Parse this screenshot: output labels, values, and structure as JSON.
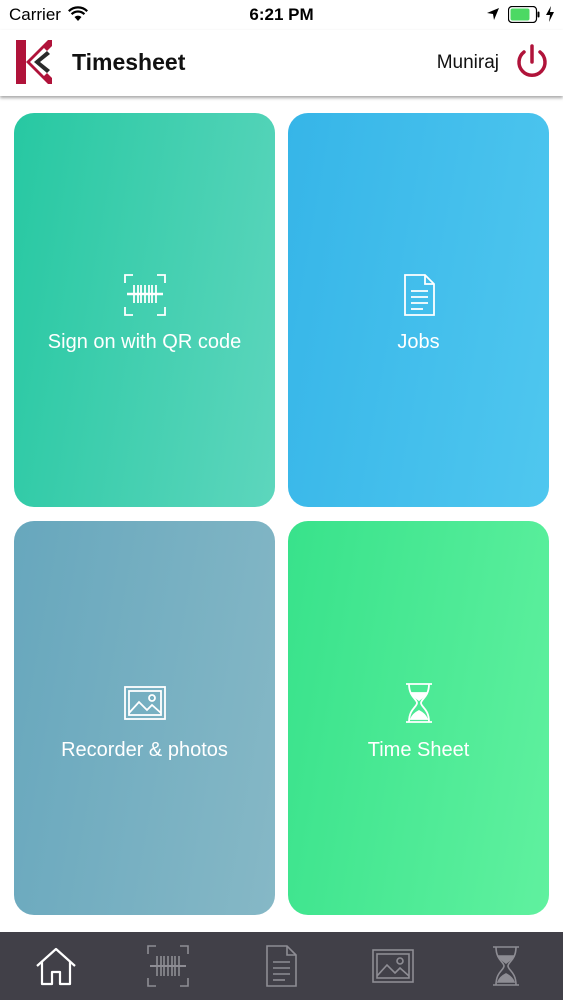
{
  "status_bar": {
    "carrier": "Carrier",
    "time": "6:21 PM",
    "icons": [
      "wifi-icon",
      "location-arrow-icon",
      "battery-icon",
      "charging-bolt-icon"
    ],
    "battery_color": "#4cd964"
  },
  "header": {
    "title": "Timesheet",
    "user_name": "Muniraj",
    "logo_icon": "company-k-logo",
    "power_icon": "power-icon",
    "brand_color": "#b0133a"
  },
  "tiles": [
    {
      "label": "Sign on with QR code",
      "icon": "qr-scan-icon",
      "color": "#27c8a2"
    },
    {
      "label": "Jobs",
      "icon": "document-icon",
      "color": "#36b5e8"
    },
    {
      "label": "Recorder & photos",
      "icon": "image-icon",
      "color": "#67a7bd"
    },
    {
      "label": "Time Sheet",
      "icon": "hourglass-icon",
      "color": "#38e28b"
    }
  ],
  "tab_bar": {
    "background": "#414048",
    "items": [
      {
        "icon": "home-icon",
        "active": true
      },
      {
        "icon": "qr-scan-icon",
        "active": false
      },
      {
        "icon": "document-icon",
        "active": false
      },
      {
        "icon": "image-icon",
        "active": false
      },
      {
        "icon": "hourglass-icon",
        "active": false
      }
    ]
  }
}
